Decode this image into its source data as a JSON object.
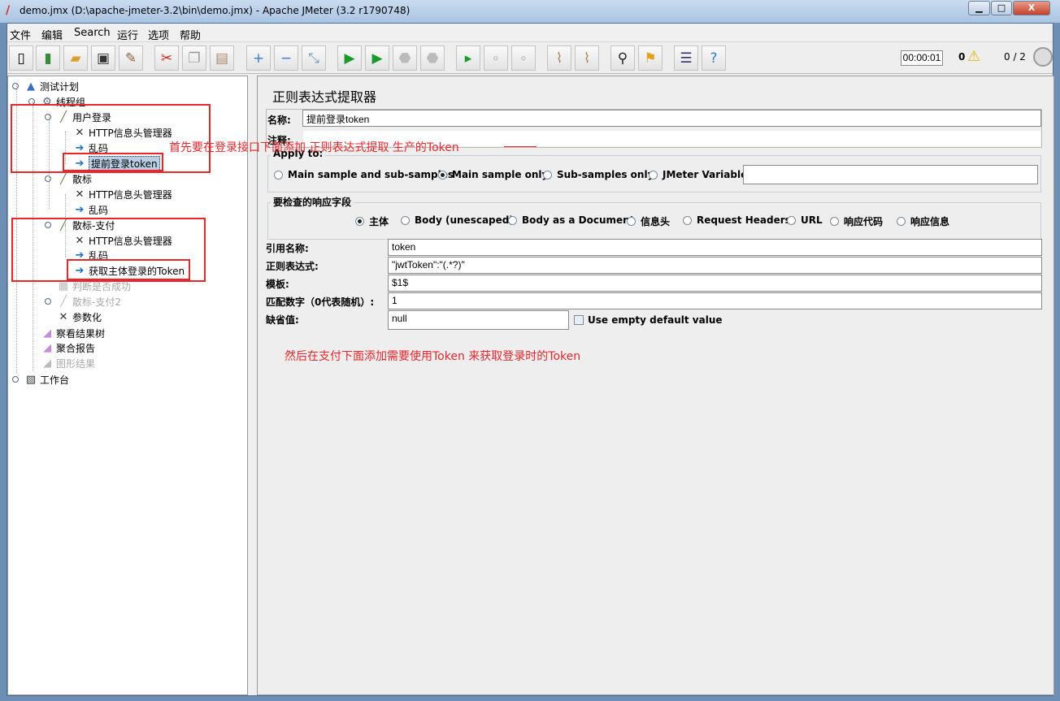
{
  "window": {
    "title": "demo.jmx (D:\\apache-jmeter-3.2\\bin\\demo.jmx) - Apache JMeter (3.2 r1790748)",
    "minimize": "▁",
    "maximize": "□",
    "close": "X"
  },
  "menu": [
    "文件",
    "编辑",
    "Search",
    "运行",
    "选项",
    "帮助"
  ],
  "toolbar": {
    "icons": [
      "new-icon",
      "templates-icon",
      "open-icon",
      "save-icon",
      "save-as-icon",
      "cut-icon",
      "copy-icon",
      "paste-icon",
      "expand-icon",
      "collapse-icon",
      "toggle-icon",
      "start-icon",
      "start-no-pause-icon",
      "stop-icon",
      "shutdown-icon",
      "remote-start-icon",
      "remote-stop-icon",
      "remote-shutdown-icon",
      "clear-icon",
      "clear-all-icon",
      "search-icon",
      "reset-search-icon",
      "function-helper-icon",
      "help-icon"
    ],
    "timer": "00:00:01",
    "error_count": "0",
    "threads": "0 / 2"
  },
  "tree": [
    {
      "label": "测试计划",
      "icon": "test-plan-icon"
    },
    {
      "label": "线程组",
      "icon": "thread-group-icon"
    },
    {
      "label": "用户登录",
      "icon": "sampler-icon"
    },
    {
      "label": "HTTP信息头管理器",
      "icon": "config-icon"
    },
    {
      "label": "乱码",
      "icon": "post-processor-icon"
    },
    {
      "label": "提前登录token",
      "icon": "post-processor-icon",
      "selected": true
    },
    {
      "label": "散标",
      "icon": "sampler-icon"
    },
    {
      "label": "HTTP信息头管理器",
      "icon": "config-icon"
    },
    {
      "label": "乱码",
      "icon": "post-processor-icon"
    },
    {
      "label": "散标-支付",
      "icon": "sampler-icon"
    },
    {
      "label": "HTTP信息头管理器",
      "icon": "config-icon"
    },
    {
      "label": "乱码",
      "icon": "post-processor-icon"
    },
    {
      "label": "获取主体登录的Token",
      "icon": "post-processor-icon"
    },
    {
      "label": "判断是否成功",
      "icon": "controller-icon",
      "disabled": true
    },
    {
      "label": "散标-支付2",
      "icon": "sampler-icon",
      "disabled": true
    },
    {
      "label": "参数化",
      "icon": "config-icon"
    },
    {
      "label": "察看结果树",
      "icon": "listener-icon"
    },
    {
      "label": "聚合报告",
      "icon": "listener-icon"
    },
    {
      "label": "图形结果",
      "icon": "listener-icon",
      "disabled": true
    },
    {
      "label": "工作台",
      "icon": "workbench-icon"
    }
  ],
  "annotations": {
    "first": "首先要在登录接口下面添加 正则表达式提取  生产的Token",
    "second": "然后在支付下面添加需要使用Token  来获取登录时的Token",
    "color": "#e8262b"
  },
  "panel": {
    "title": "正则表达式提取器",
    "name_label": "名称:",
    "name_value": "提前登录token",
    "comment_label": "注释:",
    "comment_value": "",
    "apply_to": {
      "legend": "Apply to:",
      "options": [
        "Main sample and sub-samples",
        "Main sample only",
        "Sub-samples only",
        "JMeter Variable"
      ],
      "selected": "Main sample only",
      "variable_value": ""
    },
    "field": {
      "legend": "要检查的响应字段",
      "options": [
        "主体",
        "Body (unescaped)",
        "Body as a Document",
        "信息头",
        "Request Headers",
        "URL",
        "响应代码",
        "响应信息"
      ],
      "selected": "主体"
    },
    "ref_name_label": "引用名称:",
    "ref_name": "token",
    "regex_label": "正则表达式:",
    "regex": "\"jwtToken\":\"(.*?)\"",
    "template_label": "模板:",
    "template": "$1$",
    "match_label": "匹配数字（0代表随机）:",
    "match": "1",
    "default_label": "缺省值:",
    "default": "null",
    "use_empty_label": "Use empty default value",
    "use_empty": false
  }
}
